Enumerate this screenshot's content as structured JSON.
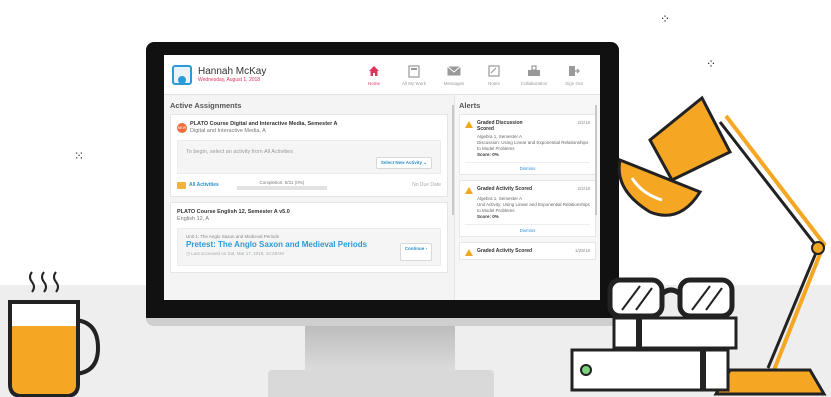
{
  "user": {
    "name": "Hannah McKay",
    "date": "Wednesday, August 1, 2018"
  },
  "nav": [
    {
      "label": "Home",
      "icon": "home-icon",
      "active": true
    },
    {
      "label": "All My Work",
      "icon": "folder-icon",
      "active": false
    },
    {
      "label": "Messages",
      "icon": "envelope-icon",
      "active": false
    },
    {
      "label": "Notes",
      "icon": "notes-icon",
      "active": false
    },
    {
      "label": "Collaboration",
      "icon": "collaboration-icon",
      "active": false
    },
    {
      "label": "Sign Out",
      "icon": "sign-out-icon",
      "active": false
    }
  ],
  "assignments": {
    "heading": "Active Assignments",
    "course1": {
      "badge": "NEW",
      "title": "PLATO Course Digital and Interactive Media, Semester A",
      "subtitle": "Digital and Interactive Media, A",
      "hint": "To begin, select an activity from All Activities",
      "select_btn": "Select New Activity",
      "all_activities": "All Activities",
      "completion": "Completion: 0/31 (0%)",
      "due": "No Due Date"
    },
    "course2": {
      "title": "PLATO Course English 12, Semester A v5.0",
      "subtitle": "English 12, A",
      "unit": "Unit 1: The Anglo Saxon and Medieval Periods",
      "pretest": "Pretest: The Anglo Saxon and Medieval Periods",
      "last_accessed": "Last accessed on Sat, Mar 17, 2018, 10:29AM",
      "continue_btn": "Continue"
    }
  },
  "alerts": {
    "heading": "Alerts",
    "items": [
      {
        "title": "Graded Discussion Scored",
        "date": "2/2/18",
        "course": "Algebra 1, Semester A",
        "detail": "Discussion: Using Linear and Exponential Relationships to Model Problems",
        "score": "Score: 0%",
        "dismiss": "Dismiss"
      },
      {
        "title": "Graded Activity Scored",
        "date": "2/2/18",
        "course": "Algebra 1, Semester A",
        "detail": "Unit Activity: Using Linear and Exponential Relationships to Model Problems",
        "score": "Score: 0%",
        "dismiss": "Dismiss"
      },
      {
        "title": "Graded Activity Scored",
        "date": "1/29/18"
      }
    ]
  },
  "colors": {
    "accent": "#2b9bd8",
    "lamp": "#f5a623",
    "date": "#e0335c",
    "warning": "#f2a81d"
  }
}
